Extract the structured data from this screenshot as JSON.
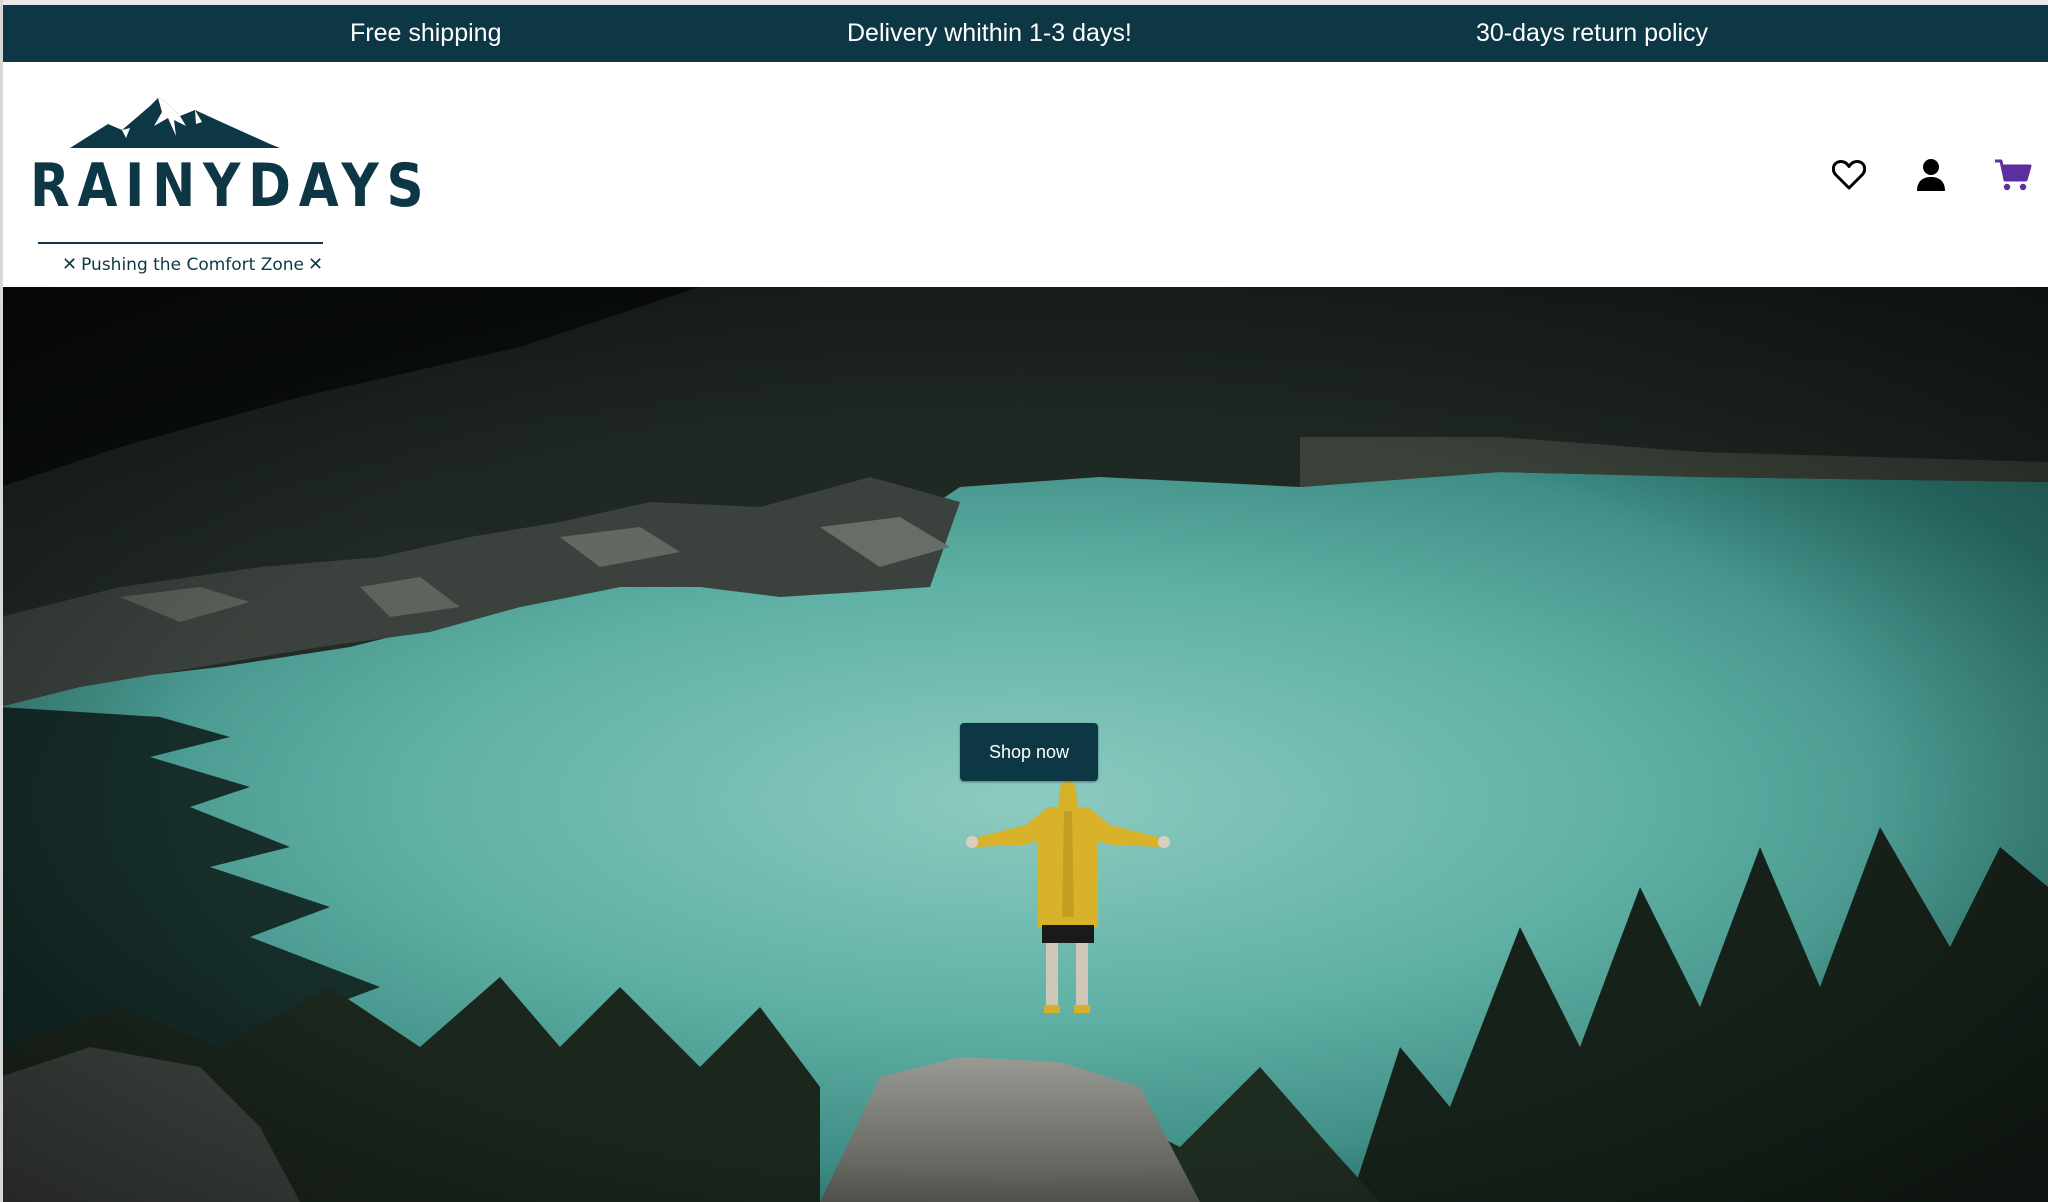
{
  "announcement": {
    "item1": "Free shipping",
    "item2": "Delivery whithin 1-3 days!",
    "item3": "30-days return policy"
  },
  "brand": {
    "name": "RAINYDAYS",
    "tagline": "Pushing the Comfort Zone",
    "tagline_mark": "✕"
  },
  "header_icons": {
    "favorites": "heart-icon",
    "account": "user-icon",
    "cart": "cart-icon"
  },
  "hero": {
    "cta_label": "Shop now"
  },
  "colors": {
    "brand_dark": "#0e3746",
    "cart_accent": "#5b2fa0",
    "lake": "#5fb3a8"
  }
}
